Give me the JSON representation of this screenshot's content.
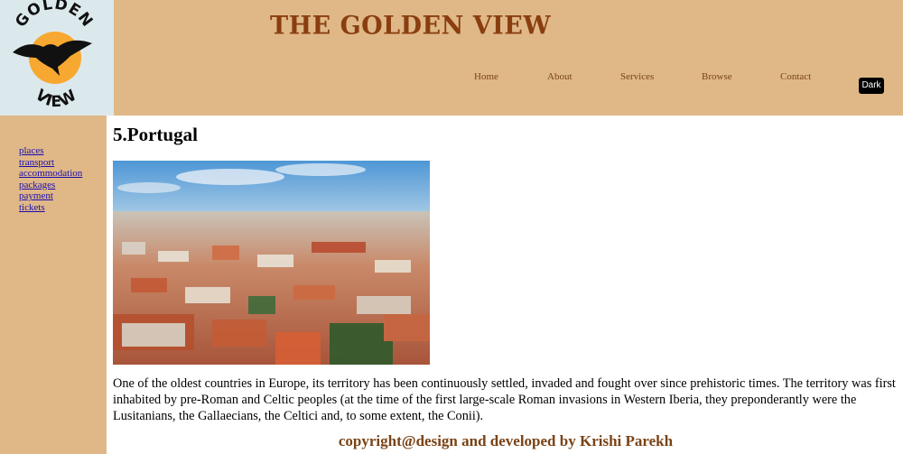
{
  "logo": {
    "line1": "GOLDEN",
    "line2": "VIEW"
  },
  "header": {
    "title": "THE GOLDEN VIEW"
  },
  "nav": {
    "home": "Home",
    "about": "About",
    "services": "Services",
    "browse": "Browse",
    "contact": "Contact"
  },
  "theme_toggle": {
    "label": "Dark"
  },
  "sidebar": {
    "links": [
      "places",
      "transport",
      "accommodation",
      "packages",
      "payment",
      "tickets"
    ]
  },
  "main": {
    "heading": "5.Portugal",
    "description": "One of the oldest countries in Europe, its territory has been continuously settled, invaded and fought over since prehistoric times. The territory was first inhabited by pre-Roman and Celtic peoples (at the time of the first large-scale Roman invasions in Western Iberia, they preponderantly were the Lusitanians, the Gallaecians, the Celtici and, to some extent, the Conii)."
  },
  "footer": {
    "text": "copyright@design and developed by Krishi Parekh"
  },
  "colors": {
    "header_bg": "#e0b887",
    "logo_bg": "#dce9ec",
    "title": "#8a3e0f",
    "nav_text": "#7a4316",
    "link": "#1a0dab"
  }
}
